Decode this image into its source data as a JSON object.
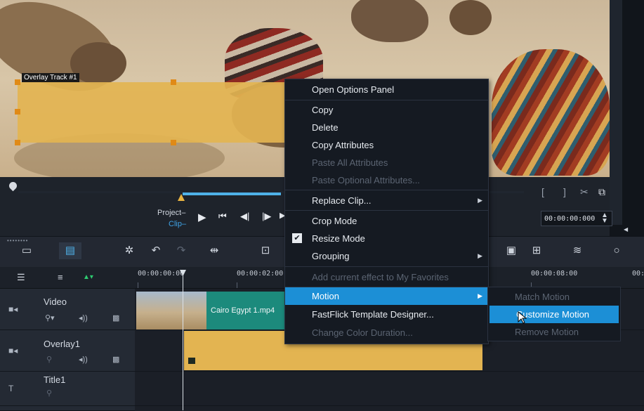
{
  "preview": {
    "overlay_track_label": "Overlay Track #1",
    "project_label": "Project",
    "clip_label": "Clip",
    "timecode": "00:00:00:000"
  },
  "ruler": {
    "times": [
      "00:00:00:00",
      "00:00:02:00",
      "00:00:08:00",
      "00:"
    ]
  },
  "tracks": [
    {
      "name": "Video",
      "clip_label": "Cairo Egypt 1.mp4"
    },
    {
      "name": "Overlay1"
    },
    {
      "name": "Title1"
    }
  ],
  "context_menu": {
    "items": [
      {
        "label": "Open Options Panel",
        "state": "normal"
      },
      {
        "label": "Copy",
        "state": "normal"
      },
      {
        "label": "Delete",
        "state": "normal"
      },
      {
        "label": "Copy Attributes",
        "state": "normal"
      },
      {
        "label": "Paste All Attributes",
        "state": "disabled"
      },
      {
        "label": "Paste Optional Attributes...",
        "state": "disabled"
      },
      {
        "label": "Replace Clip...",
        "state": "submenu"
      },
      {
        "label": "Crop Mode",
        "state": "normal"
      },
      {
        "label": "Resize Mode",
        "state": "checked"
      },
      {
        "label": "Grouping",
        "state": "submenu"
      },
      {
        "label": "Add current effect to My Favorites",
        "state": "disabled"
      },
      {
        "label": "Motion",
        "state": "highlight-submenu"
      },
      {
        "label": "FastFlick Template Designer...",
        "state": "normal"
      },
      {
        "label": "Change Color Duration...",
        "state": "disabled"
      }
    ]
  },
  "motion_submenu": {
    "items": [
      {
        "label": "Match Motion",
        "state": "disabled"
      },
      {
        "label": "Customize Motion",
        "state": "highlight"
      },
      {
        "label": "Remove Motion",
        "state": "disabled"
      }
    ]
  },
  "colors": {
    "accent": "#1c8fd6",
    "overlay_clip": "#e3b451",
    "video_clip": "#1c8a7c"
  }
}
